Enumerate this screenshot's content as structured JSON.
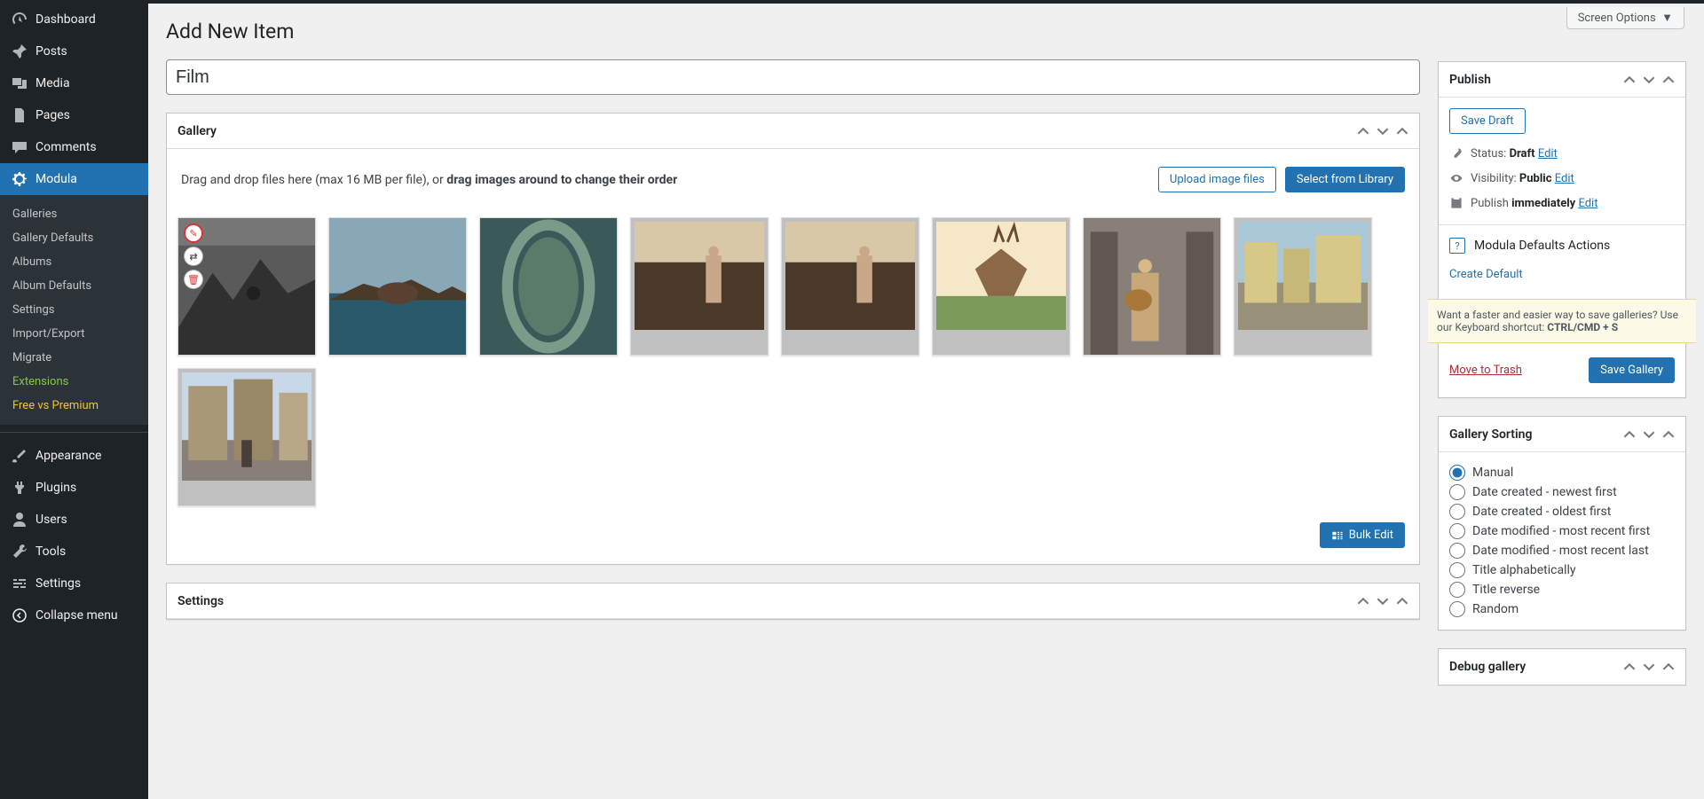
{
  "screen_options_label": "Screen Options",
  "page_title": "Add New Item",
  "title_value": "Film",
  "sidebar": {
    "main": [
      {
        "label": "Dashboard",
        "icon": "dashboard"
      },
      {
        "label": "Posts",
        "icon": "pin"
      },
      {
        "label": "Media",
        "icon": "media"
      },
      {
        "label": "Pages",
        "icon": "pages"
      },
      {
        "label": "Comments",
        "icon": "comments"
      },
      {
        "label": "Modula",
        "icon": "gear",
        "active": true
      }
    ],
    "sub": [
      {
        "label": "Galleries"
      },
      {
        "label": "Gallery Defaults"
      },
      {
        "label": "Albums"
      },
      {
        "label": "Album Defaults"
      },
      {
        "label": "Settings"
      },
      {
        "label": "Import/Export"
      },
      {
        "label": "Migrate"
      },
      {
        "label": "Extensions",
        "style": "ext"
      },
      {
        "label": "Free vs Premium",
        "style": "premium"
      }
    ],
    "lower": [
      {
        "label": "Appearance",
        "icon": "brush"
      },
      {
        "label": "Plugins",
        "icon": "plug"
      },
      {
        "label": "Users",
        "icon": "user"
      },
      {
        "label": "Tools",
        "icon": "wrench"
      },
      {
        "label": "Settings",
        "icon": "sliders"
      },
      {
        "label": "Collapse menu",
        "icon": "collapse"
      }
    ]
  },
  "gallery_box": {
    "title": "Gallery",
    "hint_pre": "Drag and drop files here (max 16 MB per file), or ",
    "hint_bold": "drag images around to change their order",
    "upload_btn": "Upload image files",
    "library_btn": "Select from Library",
    "bulk_edit": "Bulk Edit"
  },
  "settings_box": {
    "title": "Settings"
  },
  "publish": {
    "title": "Publish",
    "save_draft": "Save Draft",
    "status_label": "Status:",
    "status_value": "Draft",
    "edit": "Edit",
    "vis_label": "Visibility:",
    "vis_value": "Public",
    "pub_label": "Publish",
    "pub_value": "immediately",
    "defaults_title": "Modula Defaults Actions",
    "create_default": "Create Default",
    "shortcut_pre": "Want a faster and easier way to save galleries? Use our Keyboard shortcut: ",
    "shortcut_key": "CTRL/CMD + S",
    "trash": "Move to Trash",
    "save": "Save Gallery"
  },
  "sorting": {
    "title": "Gallery Sorting",
    "options": [
      "Manual",
      "Date created - newest first",
      "Date created - oldest first",
      "Date modified - most recent first",
      "Date modified - most recent last",
      "Title alphabetically",
      "Title reverse",
      "Random"
    ],
    "selected": "Manual"
  },
  "debug": {
    "title": "Debug gallery"
  }
}
